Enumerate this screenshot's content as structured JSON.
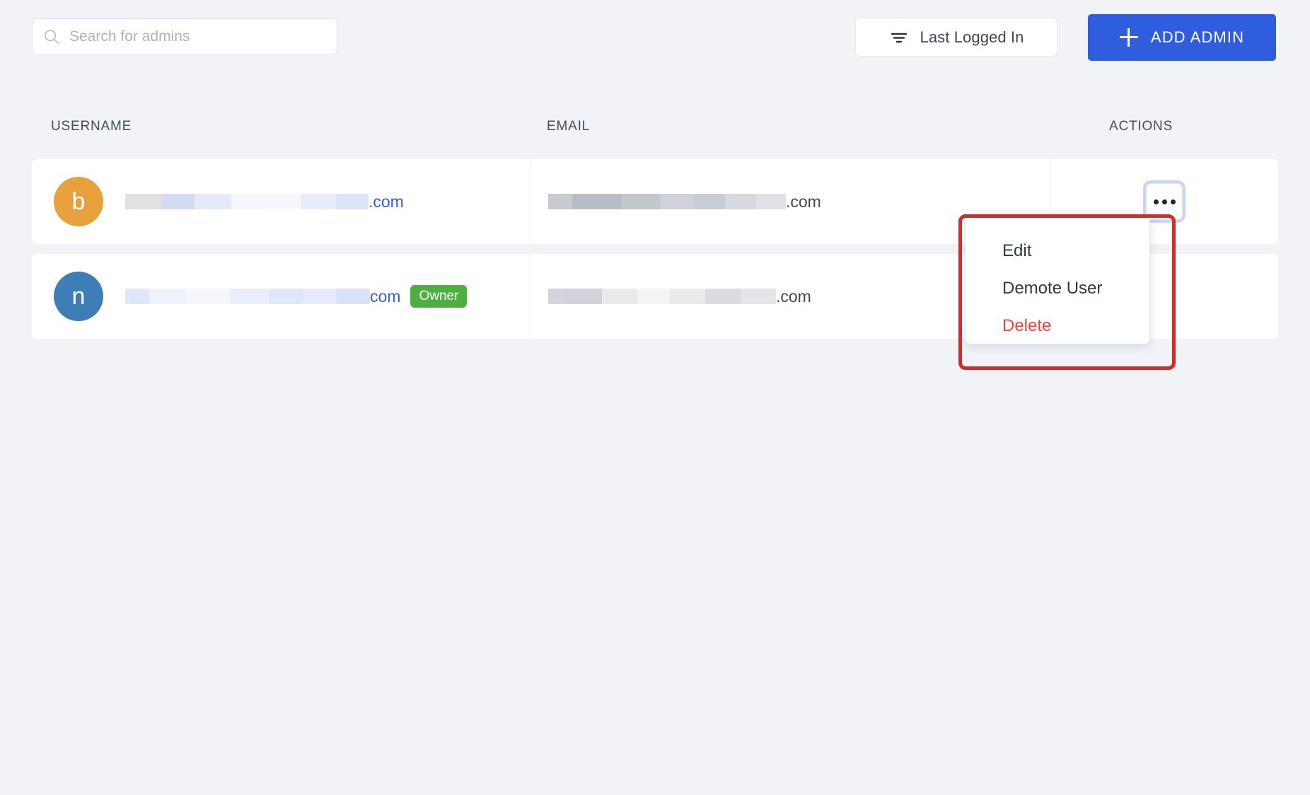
{
  "toolbar": {
    "search": {
      "placeholder": "Search for admins",
      "value": "",
      "icon": "search-icon"
    },
    "sort": {
      "label": "Last Logged In",
      "icon": "sort-filter-icon"
    },
    "add_admin": {
      "label": "ADD ADMIN",
      "icon": "plus-icon",
      "color": "#2f5ddd"
    }
  },
  "table": {
    "columns": {
      "username": "USERNAME",
      "email": "EMAIL",
      "actions": "ACTIONS"
    },
    "rows": [
      {
        "avatar_initial": "b",
        "avatar_color": "#e8a03c",
        "username_redacted": true,
        "username_tail": ".com",
        "badge": "",
        "email_redacted": true,
        "email_tail": ".com",
        "actions_icon": "ellipsis-icon",
        "menu_open": true
      },
      {
        "avatar_initial": "n",
        "avatar_color": "#3e7db5",
        "username_redacted": true,
        "username_tail": "com",
        "badge": "Owner",
        "badge_color": "#4caf3f",
        "email_redacted": true,
        "email_tail": ".com",
        "actions_icon": "ellipsis-icon",
        "menu_open": false
      }
    ]
  },
  "dropdown": {
    "items": [
      {
        "label": "Edit",
        "danger": false
      },
      {
        "label": "Demote User",
        "danger": false
      },
      {
        "label": "Delete",
        "danger": true
      }
    ]
  },
  "annotation": {
    "color": "#d32b27"
  }
}
